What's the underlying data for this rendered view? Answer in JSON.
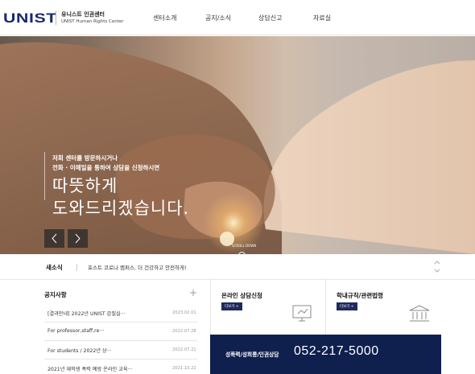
{
  "header": {
    "logo": "UNIST",
    "center_ko": "유니스트 인권센터",
    "center_en": "UNIST Human Rights Center",
    "nav": [
      "센터소개",
      "공지/소식",
      "상담신고",
      "자료실"
    ]
  },
  "hero": {
    "subtitle_line1": "저희 센터를 방문하시거나",
    "subtitle_line2": "전화 · 이메일을 통하여 상담을 신청하시면",
    "title_line1": "따뜻하게",
    "title_line2": "도와드리겠습니다.",
    "scroll_label": "SCROLL DOWN"
  },
  "news": {
    "label": "새소식",
    "text": "포스트 코로나 캠퍼스, 더 건강하고 안전하게!"
  },
  "notice": {
    "title": "공지사항",
    "items": [
      {
        "title": "[결과안내] 2022년 UNIST 갑질실···",
        "date": "2023.02.01"
      },
      {
        "title": "For professor,staff,re···",
        "date": "2022.07.28"
      },
      {
        "title": "For students / 2022년 상···",
        "date": "2022.07.21"
      },
      {
        "title": "2021년 재학생 폭력 예방 온라인 교육···",
        "date": "2021.10.22"
      }
    ]
  },
  "cards": {
    "online": {
      "title": "온라인 상담신청",
      "more": "더보기 +"
    },
    "rules": {
      "title": "학내규칙/관련법령",
      "more": "더보기 +"
    }
  },
  "phone": {
    "label": "성폭력/성희롱/인권상담",
    "number": "052-217-5000"
  },
  "icons": {
    "prev": "chevron-left-icon",
    "next": "chevron-right-icon",
    "more": "plus-icon",
    "monitor": "monitor-icon",
    "law": "courthouse-icon"
  },
  "colors": {
    "brand_navy": "#1a2a6c",
    "phone_bg": "#0f1f4e",
    "button_navy": "#1e2a5e"
  }
}
